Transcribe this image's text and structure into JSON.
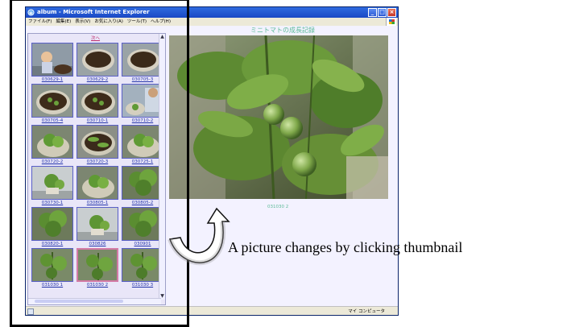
{
  "window": {
    "title": "album - Microsoft Internet Explorer",
    "controls": {
      "minimize": "_",
      "maximize": "□",
      "close": "×"
    }
  },
  "menubar": {
    "items": [
      "ファイル(F)",
      "編集(E)",
      "表示(V)",
      "お気に入り(A)",
      "ツール(T)",
      "ヘルプ(H)"
    ]
  },
  "left_frame": {
    "top_link": "次へ",
    "thumbnails": [
      {
        "label": "030629-1",
        "scene": "boy"
      },
      {
        "label": "030629-2",
        "scene": "soil-pot"
      },
      {
        "label": "030705-3",
        "scene": "soil-pot"
      },
      {
        "label": "030705-4",
        "scene": "pot-seedlings"
      },
      {
        "label": "030710-1",
        "scene": "pot-seedlings"
      },
      {
        "label": "030710-2",
        "scene": "person-pot"
      },
      {
        "label": "030720-2",
        "scene": "pot-plant"
      },
      {
        "label": "030720-3",
        "scene": "pot-leaves"
      },
      {
        "label": "030725-1",
        "scene": "pot-plant"
      },
      {
        "label": "030730-1",
        "scene": "balcony-plant"
      },
      {
        "label": "030805-1",
        "scene": "pot-plant"
      },
      {
        "label": "030805-2",
        "scene": "bushy-plant"
      },
      {
        "label": "030820-1",
        "scene": "bushy-plant"
      },
      {
        "label": "030826",
        "scene": "balcony-plant"
      },
      {
        "label": "030901",
        "scene": "bushy-plant"
      },
      {
        "label": "031030 1",
        "scene": "tall-plant"
      },
      {
        "label": "031030 2",
        "scene": "tall-plant",
        "selected": true
      },
      {
        "label": "031030 3",
        "scene": "tall-plant"
      }
    ]
  },
  "main": {
    "title": "ミニトマトの成長記録",
    "caption": "031030 2"
  },
  "statusbar": {
    "zone": "マイ コンピュータ"
  },
  "annotation": "A picture changes by clicking thumbnail"
}
